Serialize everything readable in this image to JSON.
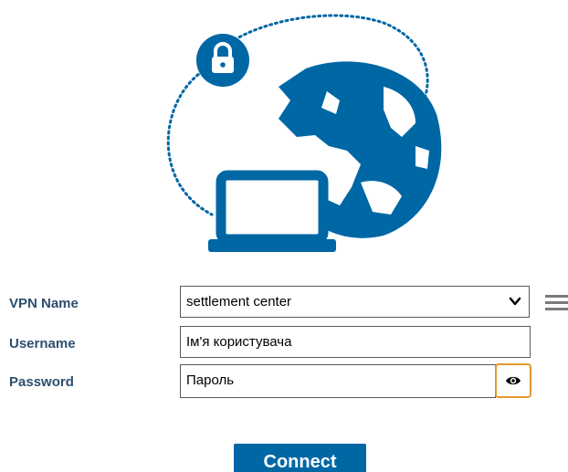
{
  "form": {
    "vpn_name_label": "VPN Name",
    "vpn_name_value": "settlement center",
    "username_label": "Username",
    "username_placeholder": "Ім'я користувача",
    "password_label": "Password",
    "password_placeholder": "Пароль"
  },
  "actions": {
    "connect_label": "Connect"
  },
  "icons": {
    "lock": "lock-icon",
    "globe": "globe-icon",
    "laptop": "laptop-icon",
    "menu": "hamburger-menu-icon",
    "eye": "eye-icon",
    "chevron": "chevron-down-icon"
  },
  "colors": {
    "brand_blue": "#0067a5",
    "label_color": "#2c4f6e",
    "focus_orange": "#e39a2c"
  }
}
